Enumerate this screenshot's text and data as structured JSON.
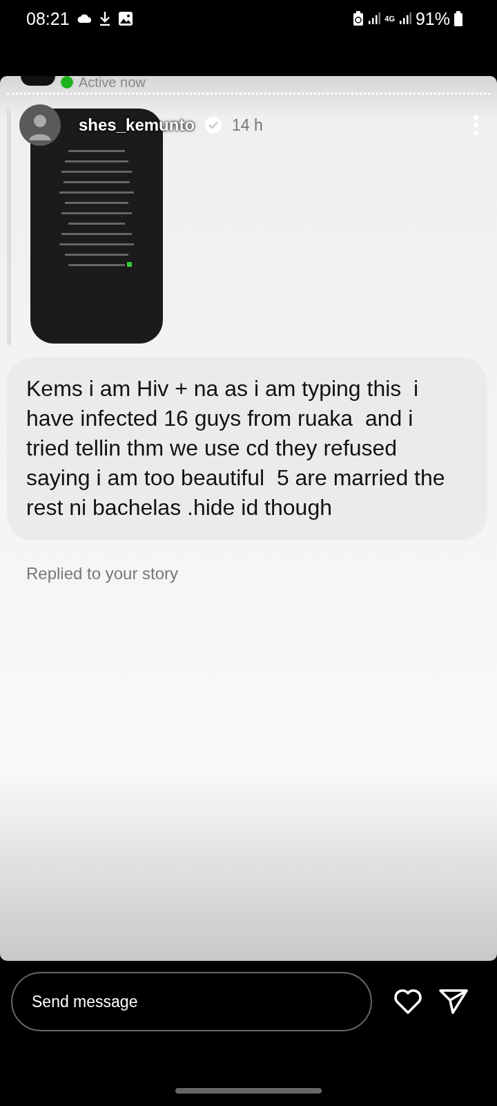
{
  "status_bar": {
    "time": "08:21",
    "network": "4G",
    "battery": "91%"
  },
  "chat_header": {
    "status": "Active now",
    "online": true
  },
  "story": {
    "username": "shes_kemunto",
    "verified": true,
    "age": "14 h"
  },
  "message": {
    "text": "Kems i am Hiv + na as i am typing this  i have infected 16 guys from ruaka  and i tried tellin thm we use cd they refused saying i am too beautiful  5 are married the rest ni bachelas .hide id though"
  },
  "reply_note": "Replied to your story",
  "composer": {
    "placeholder": "Send message"
  }
}
